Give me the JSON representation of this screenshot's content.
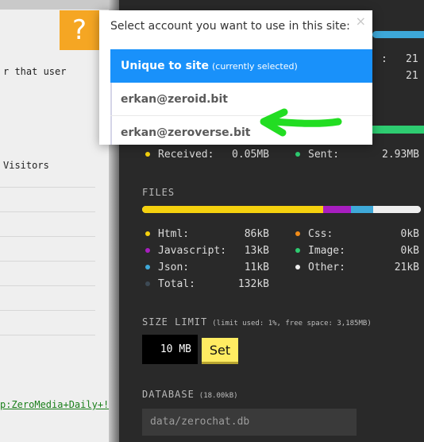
{
  "background_page": {
    "line1": "r that user",
    "line2": "Visitors",
    "link": "p:ZeroMedia+Daily+!"
  },
  "sidebar": {
    "peers": {
      "value1": "21",
      "value2": "21",
      "colon": ":"
    },
    "transfer": {
      "received_label": "Received:",
      "received_value": "0.05MB",
      "sent_label": "Sent:",
      "sent_value": "2.93MB"
    },
    "files": {
      "title": "FILES",
      "segments": [
        {
          "name": "Html",
          "fraction": 0.65,
          "color": "#f5d10e"
        },
        {
          "name": "Javascript",
          "fraction": 0.1,
          "color": "#a81ec0"
        },
        {
          "name": "Json",
          "fraction": 0.08,
          "color": "#3fa9d9"
        },
        {
          "name": "Other",
          "fraction": 0.17,
          "color": "#eeeeee"
        }
      ],
      "items": {
        "html": {
          "label": "Html:",
          "value": "86kB",
          "color": "#f5d10e"
        },
        "javascript": {
          "label": "Javascript:",
          "value": "13kB",
          "color": "#a81ec0"
        },
        "json": {
          "label": "Json:",
          "value": "11kB",
          "color": "#3fa9d9"
        },
        "total": {
          "label": "Total:",
          "value": "132kB",
          "color": "#3d4a55"
        },
        "css": {
          "label": "Css:",
          "value": "0kB",
          "color": "#f28c18"
        },
        "image": {
          "label": "Image:",
          "value": "0kB",
          "color": "#2ecc71"
        },
        "other": {
          "label": "Other:",
          "value": "21kB",
          "color": "#eeeeee"
        }
      },
      "received_dot_color": "#f5d10e",
      "sent_dot_color": "#2ecc71"
    },
    "size_limit": {
      "title": "SIZE LIMIT",
      "note": "(limit used: 1%, free space: 3,185MB)",
      "input_value": "10 MB",
      "set_label": "Set"
    },
    "database": {
      "title": "DATABASE",
      "note": "(18.00kB)",
      "path": "data/zerochat.db"
    }
  },
  "account_dialog": {
    "icon": "question-mark-icon",
    "icon_glyph": "?",
    "title": "Select account you want to use in this site:",
    "close_glyph": "×",
    "accounts": [
      {
        "name": "Unique to site",
        "note": "(currently selected)"
      },
      {
        "name": "erkan@zeroid.bit"
      },
      {
        "name": "erkan@zeroverse.bit"
      }
    ],
    "accent_color": "#1991fa",
    "arrow_color": "#22dd22"
  }
}
